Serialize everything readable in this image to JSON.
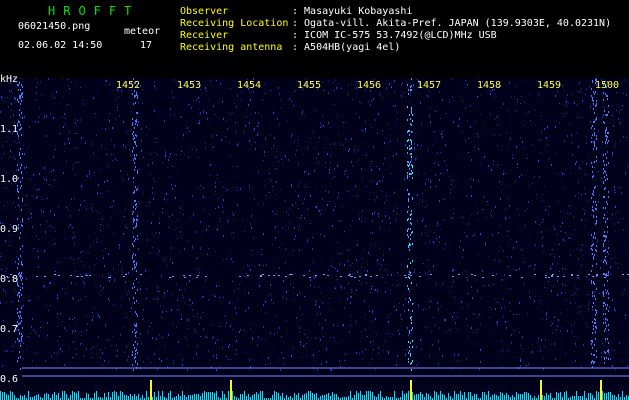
{
  "header": {
    "logo": "HROFFT",
    "filename": "06021450.png",
    "datetime": "02.06.02 14:50",
    "count_label": "meteor",
    "count_value": "17",
    "info": [
      {
        "key": "Observer",
        "value": ": Masayuki Kobayashi"
      },
      {
        "key": "Receiving Location",
        "value": ": Ogata-vill. Akita-Pref. JAPAN (139.9303E, 40.0231N)"
      },
      {
        "key": "Receiver",
        "value": ": ICOM IC-575 53.7492(@LCD)MHz USB"
      },
      {
        "key": "Receiving antenna",
        "value": ": A504HB(yagi 4el)"
      }
    ]
  },
  "axes": {
    "y_unit": "kHz",
    "y_ticks": [
      "1.1",
      "1.0",
      "0.9",
      "0.8",
      "0.7",
      "0.6"
    ],
    "x_ticks": [
      "1452",
      "1453",
      "1454",
      "1455",
      "1456",
      "1457",
      "1458",
      "1459",
      "1500"
    ]
  },
  "colors": {
    "background": "#000000",
    "spectrum": "#2040ff",
    "highlight": "#00ffff",
    "label": "#ffff00",
    "logo": "#00e000"
  }
}
